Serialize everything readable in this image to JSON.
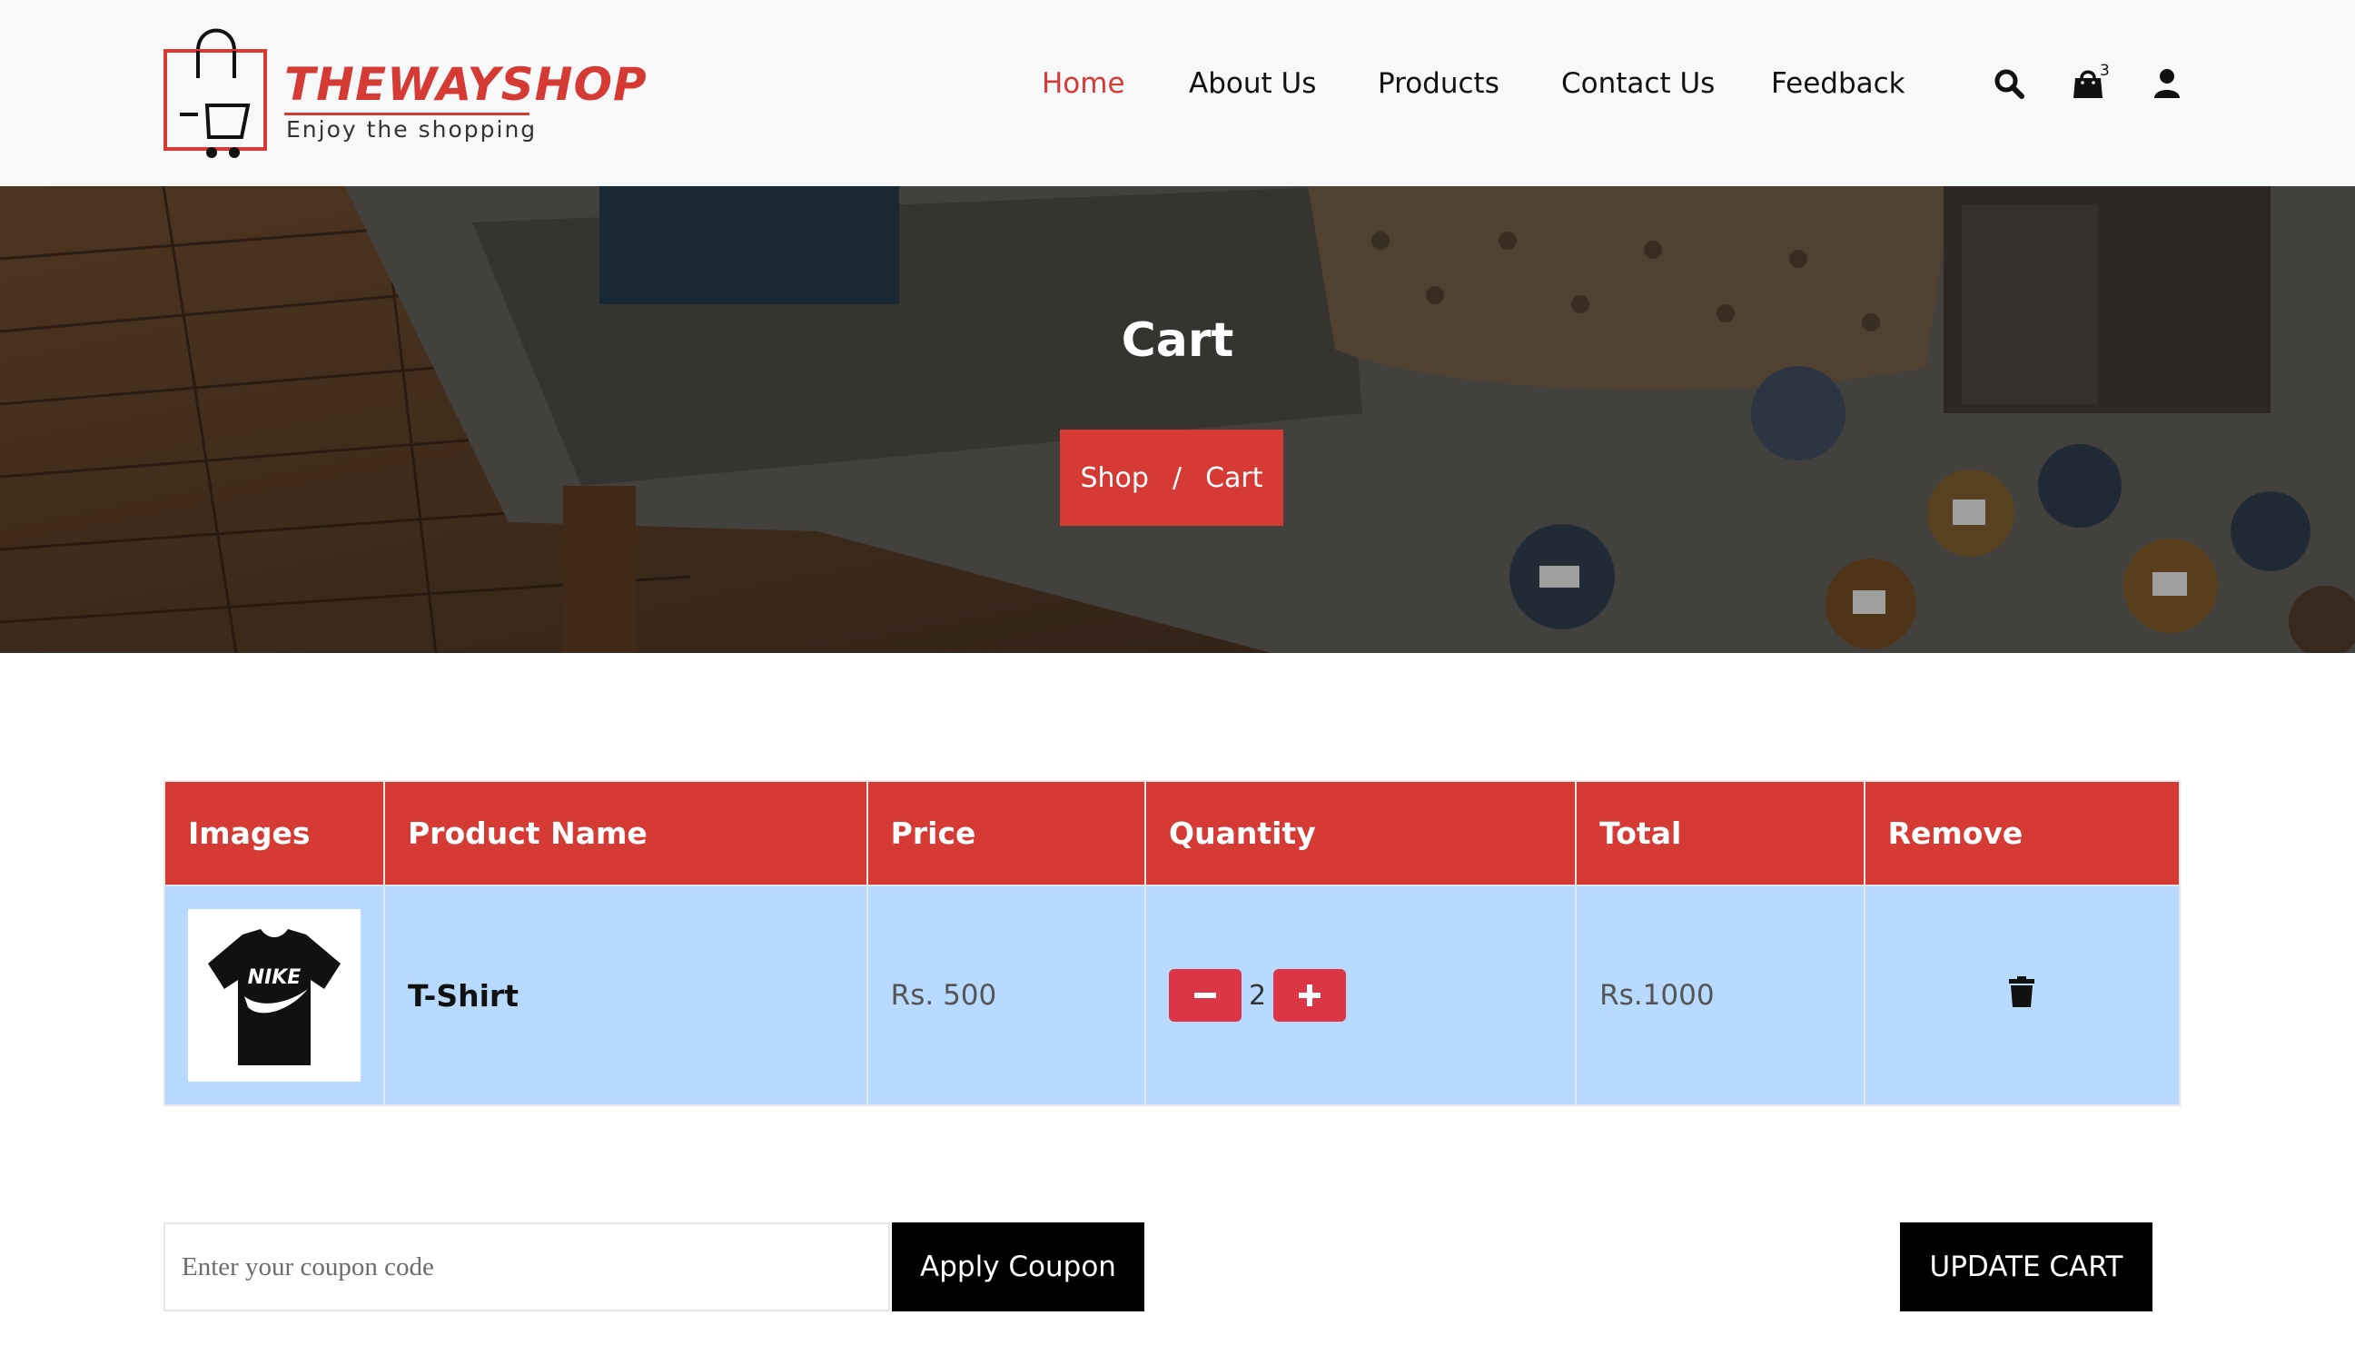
{
  "brand": {
    "name": "THEWAYSHOP",
    "tagline": "Enjoy the shopping",
    "accent": "#d63a35"
  },
  "nav": {
    "items": [
      {
        "label": "Home",
        "active": true
      },
      {
        "label": "About Us",
        "active": false
      },
      {
        "label": "Products",
        "active": false
      },
      {
        "label": "Contact Us",
        "active": false
      },
      {
        "label": "Feedback",
        "active": false
      }
    ],
    "icons": [
      "search-icon",
      "shopping-bag-icon",
      "user-icon"
    ],
    "cart_count": "3"
  },
  "banner": {
    "title": "Cart",
    "breadcrumb": {
      "parent": "Shop",
      "separator": "/",
      "current": "Cart"
    }
  },
  "cart_table": {
    "headers": [
      "Images",
      "Product Name",
      "Price",
      "Quantity",
      "Total",
      "Remove"
    ],
    "rows": [
      {
        "image_logo_text": "NIKE",
        "product_name": "T-Shirt",
        "price": "Rs. 500",
        "quantity": "2",
        "total": "Rs.1000",
        "remove_icon": "trash-icon"
      }
    ],
    "header_color": "#d63a35",
    "row_color": "#b8daff"
  },
  "coupon": {
    "placeholder": "Enter your coupon code",
    "value": "",
    "apply_label": "Apply Coupon"
  },
  "update_label": "UPDATE CART"
}
